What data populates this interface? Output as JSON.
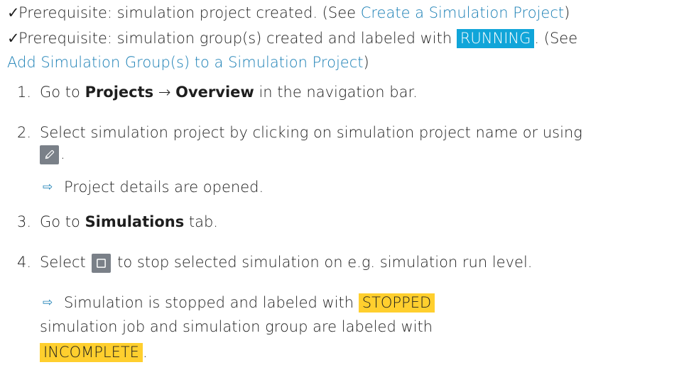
{
  "prerequisites": [
    {
      "check": "✓",
      "text_before": "Prerequisite: simulation project created. (See ",
      "link": "Create a Simulation Project",
      "text_after": ")"
    },
    {
      "check": "✓",
      "text_before": "Prerequisite: simulation group(s) created and labeled with ",
      "badge": "RUNNING",
      "text_middle": ". (See",
      "link": "Add Simulation Group(s) to a Simulation Project",
      "text_after": ")"
    }
  ],
  "steps": [
    {
      "num": "1.",
      "pre": "Go to ",
      "bold1": "Projects",
      "arrow": " → ",
      "bold2": "Overview",
      "post": " in the navigation bar."
    },
    {
      "num": "2.",
      "line1": "Select simulation project by clicking on simulation project name or using",
      "after_icon": ".",
      "result": "Project details are opened."
    },
    {
      "num": "3.",
      "pre": "Go to ",
      "bold": "Simulations",
      "post": " tab."
    },
    {
      "num": "4.",
      "pre": "Select ",
      "post": " to stop selected simulation on e.g. simulation run level.",
      "result": {
        "line1_pre": "Simulation is stopped and labeled with ",
        "badge1": "STOPPED",
        "line2": "simulation job and simulation group are labeled with",
        "badge2": "INCOMPLETE",
        "line3_post": "."
      }
    }
  ],
  "result_arrow": "⇨",
  "colors": {
    "link": "#1a7fb5",
    "running": "#10a5d9",
    "stopped": "#ffcf2e",
    "icon_bg": "#7a8088"
  },
  "icons": {
    "edit": "pencil-icon",
    "stop": "stop-square-icon"
  }
}
